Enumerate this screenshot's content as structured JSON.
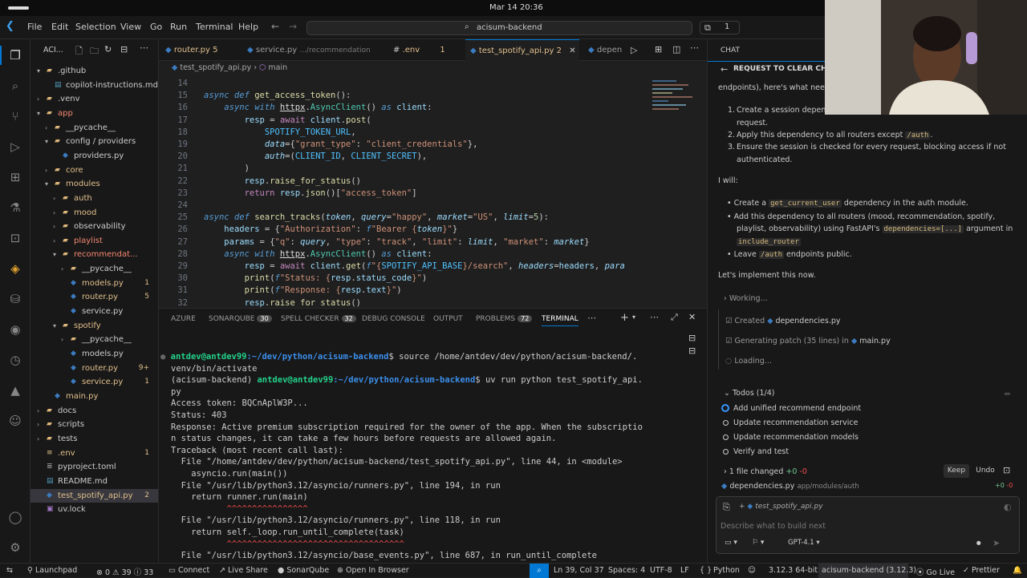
{
  "topbar": {
    "clock": "Mar 14  20:36"
  },
  "menubar": {
    "items": [
      "File",
      "Edit",
      "Selection",
      "View",
      "Go",
      "Run",
      "Terminal",
      "Help"
    ],
    "search": "acisum-backend",
    "chat_count": "1"
  },
  "sidebar": {
    "title": "ACI...",
    "rows": [
      {
        "label": ".github",
        "color": "#cccccc",
        "badge": ""
      },
      {
        "label": "copilot-instructions.md",
        "color": "#cccccc",
        "badge": ""
      },
      {
        "label": ".venv",
        "color": "#cccccc",
        "badge": ""
      },
      {
        "label": "app",
        "color": "#f48771",
        "badge": ""
      },
      {
        "label": "__pycache__",
        "color": "#cccccc",
        "badge": ""
      },
      {
        "label": "config / providers",
        "color": "#cccccc",
        "badge": ""
      },
      {
        "label": "providers.py",
        "color": "#cccccc",
        "badge": ""
      },
      {
        "label": "core",
        "color": "#e2c08d",
        "badge": ""
      },
      {
        "label": "modules",
        "color": "#e2c08d",
        "badge": ""
      },
      {
        "label": "auth",
        "color": "#e2c08d",
        "badge": ""
      },
      {
        "label": "mood",
        "color": "#e2c08d",
        "badge": ""
      },
      {
        "label": "observability",
        "color": "#cccccc",
        "badge": ""
      },
      {
        "label": "playlist",
        "color": "#f48771",
        "badge": ""
      },
      {
        "label": "recommendat...",
        "color": "#f48771",
        "badge": ""
      },
      {
        "label": "__pycache__",
        "color": "#cccccc",
        "badge": ""
      },
      {
        "label": "models.py",
        "color": "#e2c08d",
        "badge": "1"
      },
      {
        "label": "router.py",
        "color": "#e2c08d",
        "badge": "5"
      },
      {
        "label": "service.py",
        "color": "#cccccc",
        "badge": ""
      },
      {
        "label": "spotify",
        "color": "#e2c08d",
        "badge": ""
      },
      {
        "label": "__pycache__",
        "color": "#cccccc",
        "badge": ""
      },
      {
        "label": "models.py",
        "color": "#cccccc",
        "badge": ""
      },
      {
        "label": "router.py",
        "color": "#e2c08d",
        "badge": "9+"
      },
      {
        "label": "service.py",
        "color": "#e2c08d",
        "badge": "1"
      },
      {
        "label": "main.py",
        "color": "#e2c08d",
        "badge": ""
      },
      {
        "label": "docs",
        "color": "#cccccc",
        "badge": ""
      },
      {
        "label": "scripts",
        "color": "#cccccc",
        "badge": ""
      },
      {
        "label": "tests",
        "color": "#cccccc",
        "badge": ""
      },
      {
        "label": ".env",
        "color": "#e2c08d",
        "badge": "1"
      },
      {
        "label": "pyproject.toml",
        "color": "#cccccc",
        "badge": ""
      },
      {
        "label": "README.md",
        "color": "#cccccc",
        "badge": ""
      },
      {
        "label": "test_spotify_api.py",
        "color": "#e2c08d",
        "badge": "2"
      },
      {
        "label": "uv.lock",
        "color": "#cccccc",
        "badge": ""
      }
    ]
  },
  "editor": {
    "tabs": [
      {
        "label": "router.py",
        "badge": "5",
        "hint": ""
      },
      {
        "label": "service.py",
        "badge": "",
        "hint": ".../recommendation"
      },
      {
        "label": ".env",
        "badge": "1",
        "hint": ""
      },
      {
        "label": "test_spotify_api.py",
        "badge": "2",
        "hint": ""
      },
      {
        "label": "depen",
        "badge": "",
        "hint": ""
      }
    ],
    "breadcrumb": [
      "test_spotify_api.py",
      "main"
    ],
    "line_numbers": [
      "14",
      "15",
      "16",
      "17",
      "18",
      "19",
      "20",
      "21",
      "22",
      "23",
      "24",
      "25",
      "26",
      "27",
      "28",
      "29",
      "30",
      "31",
      "32"
    ]
  },
  "panel": {
    "tabs": [
      {
        "label": "AZURE",
        "badge": ""
      },
      {
        "label": "SONARQUBE",
        "badge": "30"
      },
      {
        "label": "SPELL CHECKER",
        "badge": "32"
      },
      {
        "label": "DEBUG CONSOLE",
        "badge": ""
      },
      {
        "label": "OUTPUT",
        "badge": ""
      },
      {
        "label": "PROBLEMS",
        "badge": "72"
      },
      {
        "label": "TERMINAL",
        "badge": ""
      }
    ],
    "prompt_user": "antdev@antdev99",
    "prompt_path": ":~/dev/python/acisum-backend",
    "cmd1": " source /home/antdev/dev/python/acisum-backend/.",
    "cmd1b": "venv/bin/activate",
    "venv": "(acisum-backend) ",
    "cmd2": " uv run python test_spotify_api.",
    "cmd2b": "py",
    "output": [
      "Access token: BQCnAplW3P...",
      "Status: 403",
      "Response: Active premium subscription required for the owner of the app. When the subscriptio",
      "n status changes, it can take a few hours before requests are allowed again.",
      "Traceback (most recent call last):",
      "  File \"/home/antdev/dev/python/acisum-backend/test_spotify_api.py\", line 44, in <module>",
      "    asyncio.run(main())",
      "  File \"/usr/lib/python3.12/asyncio/runners.py\", line 194, in run",
      "    return runner.run(main)",
      "           ^^^^^^^^^^^^^^^^",
      "  File \"/usr/lib/python3.12/asyncio/runners.py\", line 118, in run",
      "    return self._loop.run_until_complete(task)",
      "           ^^^^^^^^^^^^^^^^^^^^^^^^^^^^^^^^^^^",
      "  File \"/usr/lib/python3.12/asyncio/base_events.py\", line 687, in run_until_complete"
    ]
  },
  "chat": {
    "title": "CHAT",
    "subtitle": "REQUEST TO CLEAR CHAT H",
    "intro": "endpoints), here's what need",
    "list1": [
      "Create a session depend",
      "request.",
      "Apply this dependency to all routers except",
      "/auth",
      "Ensure the session is checked for every request, blocking access if not",
      "authenticated."
    ],
    "will": "I will:",
    "b1a": "Create a",
    "b1code": "get_current_user",
    "b1b": "dependency in the auth module.",
    "b2a": "Add this dependency to all routers (mood, recommendation, spotify,",
    "b2b": "playlist, observability) using FastAPI's",
    "b2code": "dependencies=[...]",
    "b2c": "argument in",
    "b2d": "include_router",
    "b3a": "Leave",
    "b3code": "/auth",
    "b3b": "endpoints public.",
    "implement": "Let's implement this now.",
    "working": "Working...",
    "created": "Created",
    "created_file": "dependencies.py",
    "generating": "Generating patch (35 lines) in",
    "generating_file": "main.py",
    "loading": "Loading...",
    "todos_title": "Todos (1/4)",
    "todos": [
      "Add unified recommend endpoint",
      "Update recommendation service",
      "Update recommendation models",
      "Verify and test"
    ],
    "changed": "1 file changed",
    "changed_add": "+0",
    "changed_del": "-0",
    "keep": "Keep",
    "undo": "Undo",
    "changed_file": "dependencies.py",
    "changed_path": "app/modules/auth",
    "attach_file": "test_spotify_api.py",
    "placeholder": "Describe what to build next",
    "model": "GPT-4.1"
  },
  "statusbar": {
    "launchpad": "Launchpad",
    "errors": "0",
    "warnings": "39",
    "infos": "33",
    "connect": "Connect",
    "liveshare": "Live Share",
    "sonar": "SonarQube",
    "browser": "Open In Browser",
    "position": "Ln 39, Col 37",
    "spaces": "Spaces: 4",
    "encoding": "UTF-8",
    "eol": "LF",
    "language": "Python",
    "python_ver": "3.12.3 64-bit",
    "venv": "acisum-backend (3.12.3)",
    "golive": "Go Live",
    "prettier": "Prettier"
  },
  "colors": {
    "accent": "#0078d4",
    "folder": "#dcb67a",
    "python": "#3b7bbf"
  }
}
